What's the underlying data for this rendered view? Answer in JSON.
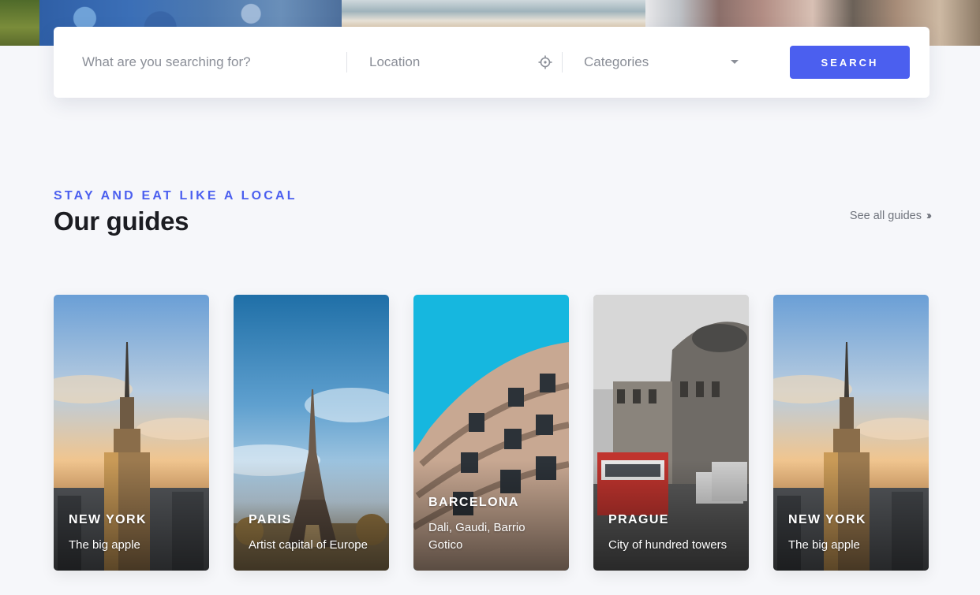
{
  "search": {
    "query_placeholder": "What are you searching for?",
    "location_placeholder": "Location",
    "category_value": "Categories",
    "button_label": "SEARCH"
  },
  "section": {
    "eyebrow": "STAY AND EAT LIKE A LOCAL",
    "title": "Our guides",
    "see_all_label": "See all guides",
    "see_all_icon": "double-chevron-right-icon"
  },
  "guides": [
    {
      "city": "NEW YORK",
      "description": "The big apple",
      "image": "empire-state-building"
    },
    {
      "city": "PARIS",
      "description": "Artist capital of Europe",
      "image": "eiffel-tower"
    },
    {
      "city": "BARCELONA",
      "description": "Dali, Gaudi, Barrio Gotico",
      "image": "casa-mila"
    },
    {
      "city": "PRAGUE",
      "description": "City of hundred towers",
      "image": "national-theatre-tram"
    },
    {
      "city": "NEW YORK",
      "description": "The big apple",
      "image": "empire-state-building"
    }
  ],
  "colors": {
    "accent": "#4b5fef",
    "background": "#f6f7fa",
    "heading": "#1c1d22",
    "muted": "#8b8f98"
  }
}
